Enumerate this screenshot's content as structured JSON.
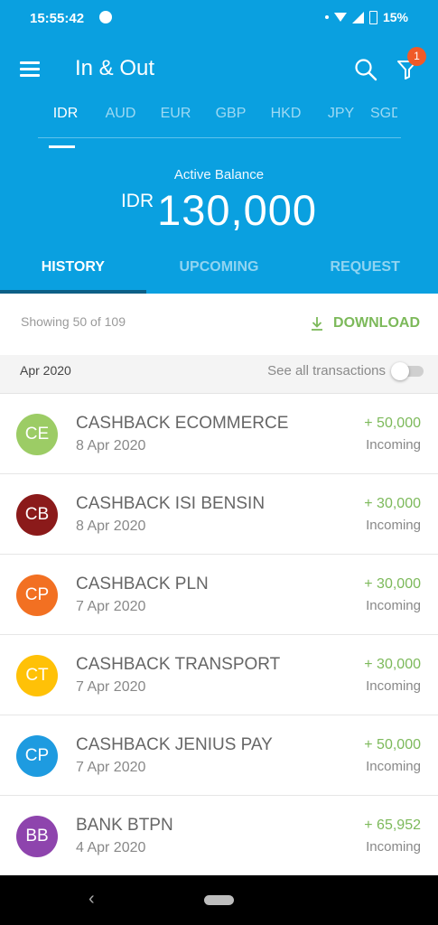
{
  "status_bar": {
    "time": "15:55:42",
    "battery": "15%"
  },
  "app": {
    "title": "In & Out",
    "filter_badge": "1"
  },
  "currency_tabs": [
    {
      "label": "IDR",
      "active": true
    },
    {
      "label": "AUD"
    },
    {
      "label": "EUR"
    },
    {
      "label": "GBP"
    },
    {
      "label": "HKD"
    },
    {
      "label": "JPY"
    },
    {
      "label": "SGD"
    }
  ],
  "balance": {
    "label": "Active Balance",
    "currency": "IDR",
    "amount": "130,000"
  },
  "main_tabs": [
    {
      "label": "HISTORY",
      "active": true
    },
    {
      "label": "UPCOMING"
    },
    {
      "label": "REQUEST"
    }
  ],
  "list_header": {
    "showing": "Showing 50 of 109",
    "download_label": "DOWNLOAD"
  },
  "month_bar": {
    "month": "Apr 2020",
    "see_all_label": "See all transactions",
    "see_all_on": false
  },
  "transactions": [
    {
      "initials": "CE",
      "name": "CASHBACK ECOMMERCE",
      "date": "8 Apr 2020",
      "amount": "+ 50,000",
      "type": "Incoming",
      "color": "#9ccc65"
    },
    {
      "initials": "CB",
      "name": "CASHBACK ISI BENSIN",
      "date": "8 Apr 2020",
      "amount": "+ 30,000",
      "type": "Incoming",
      "color": "#8b1a1a"
    },
    {
      "initials": "CP",
      "name": "CASHBACK PLN",
      "date": "7 Apr 2020",
      "amount": "+ 30,000",
      "type": "Incoming",
      "color": "#f27022"
    },
    {
      "initials": "CT",
      "name": "CASHBACK TRANSPORT",
      "date": "7 Apr 2020",
      "amount": "+ 30,000",
      "type": "Incoming",
      "color": "#ffc107"
    },
    {
      "initials": "CP",
      "name": "CASHBACK JENIUS PAY",
      "date": "7 Apr 2020",
      "amount": "+ 50,000",
      "type": "Incoming",
      "color": "#1e9be0"
    },
    {
      "initials": "BB",
      "name": "BANK BTPN",
      "date": "4 Apr 2020",
      "amount": "+ 65,952",
      "type": "Incoming",
      "color": "#8e44ad"
    }
  ],
  "icons": {
    "menu": "menu-icon",
    "search": "search-icon",
    "filter": "filter-icon",
    "download": "download-icon",
    "back": "back-icon",
    "home": "home-pill-icon"
  },
  "colors": {
    "header_bg": "#0aa0e0",
    "accent_green": "#7cb95a",
    "badge": "#f05a28"
  }
}
